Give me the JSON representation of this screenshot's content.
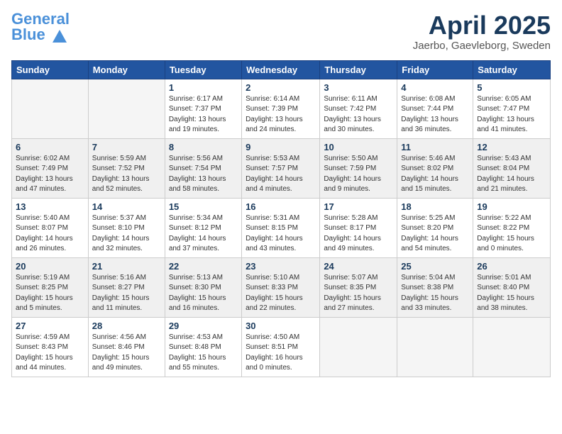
{
  "header": {
    "logo_line1": "General",
    "logo_line2": "Blue",
    "month": "April 2025",
    "location": "Jaerbo, Gaevleborg, Sweden"
  },
  "weekdays": [
    "Sunday",
    "Monday",
    "Tuesday",
    "Wednesday",
    "Thursday",
    "Friday",
    "Saturday"
  ],
  "weeks": [
    [
      {
        "day": "",
        "text": ""
      },
      {
        "day": "",
        "text": ""
      },
      {
        "day": "1",
        "text": "Sunrise: 6:17 AM\nSunset: 7:37 PM\nDaylight: 13 hours\nand 19 minutes."
      },
      {
        "day": "2",
        "text": "Sunrise: 6:14 AM\nSunset: 7:39 PM\nDaylight: 13 hours\nand 24 minutes."
      },
      {
        "day": "3",
        "text": "Sunrise: 6:11 AM\nSunset: 7:42 PM\nDaylight: 13 hours\nand 30 minutes."
      },
      {
        "day": "4",
        "text": "Sunrise: 6:08 AM\nSunset: 7:44 PM\nDaylight: 13 hours\nand 36 minutes."
      },
      {
        "day": "5",
        "text": "Sunrise: 6:05 AM\nSunset: 7:47 PM\nDaylight: 13 hours\nand 41 minutes."
      }
    ],
    [
      {
        "day": "6",
        "text": "Sunrise: 6:02 AM\nSunset: 7:49 PM\nDaylight: 13 hours\nand 47 minutes."
      },
      {
        "day": "7",
        "text": "Sunrise: 5:59 AM\nSunset: 7:52 PM\nDaylight: 13 hours\nand 52 minutes."
      },
      {
        "day": "8",
        "text": "Sunrise: 5:56 AM\nSunset: 7:54 PM\nDaylight: 13 hours\nand 58 minutes."
      },
      {
        "day": "9",
        "text": "Sunrise: 5:53 AM\nSunset: 7:57 PM\nDaylight: 14 hours\nand 4 minutes."
      },
      {
        "day": "10",
        "text": "Sunrise: 5:50 AM\nSunset: 7:59 PM\nDaylight: 14 hours\nand 9 minutes."
      },
      {
        "day": "11",
        "text": "Sunrise: 5:46 AM\nSunset: 8:02 PM\nDaylight: 14 hours\nand 15 minutes."
      },
      {
        "day": "12",
        "text": "Sunrise: 5:43 AM\nSunset: 8:04 PM\nDaylight: 14 hours\nand 21 minutes."
      }
    ],
    [
      {
        "day": "13",
        "text": "Sunrise: 5:40 AM\nSunset: 8:07 PM\nDaylight: 14 hours\nand 26 minutes."
      },
      {
        "day": "14",
        "text": "Sunrise: 5:37 AM\nSunset: 8:10 PM\nDaylight: 14 hours\nand 32 minutes."
      },
      {
        "day": "15",
        "text": "Sunrise: 5:34 AM\nSunset: 8:12 PM\nDaylight: 14 hours\nand 37 minutes."
      },
      {
        "day": "16",
        "text": "Sunrise: 5:31 AM\nSunset: 8:15 PM\nDaylight: 14 hours\nand 43 minutes."
      },
      {
        "day": "17",
        "text": "Sunrise: 5:28 AM\nSunset: 8:17 PM\nDaylight: 14 hours\nand 49 minutes."
      },
      {
        "day": "18",
        "text": "Sunrise: 5:25 AM\nSunset: 8:20 PM\nDaylight: 14 hours\nand 54 minutes."
      },
      {
        "day": "19",
        "text": "Sunrise: 5:22 AM\nSunset: 8:22 PM\nDaylight: 15 hours\nand 0 minutes."
      }
    ],
    [
      {
        "day": "20",
        "text": "Sunrise: 5:19 AM\nSunset: 8:25 PM\nDaylight: 15 hours\nand 5 minutes."
      },
      {
        "day": "21",
        "text": "Sunrise: 5:16 AM\nSunset: 8:27 PM\nDaylight: 15 hours\nand 11 minutes."
      },
      {
        "day": "22",
        "text": "Sunrise: 5:13 AM\nSunset: 8:30 PM\nDaylight: 15 hours\nand 16 minutes."
      },
      {
        "day": "23",
        "text": "Sunrise: 5:10 AM\nSunset: 8:33 PM\nDaylight: 15 hours\nand 22 minutes."
      },
      {
        "day": "24",
        "text": "Sunrise: 5:07 AM\nSunset: 8:35 PM\nDaylight: 15 hours\nand 27 minutes."
      },
      {
        "day": "25",
        "text": "Sunrise: 5:04 AM\nSunset: 8:38 PM\nDaylight: 15 hours\nand 33 minutes."
      },
      {
        "day": "26",
        "text": "Sunrise: 5:01 AM\nSunset: 8:40 PM\nDaylight: 15 hours\nand 38 minutes."
      }
    ],
    [
      {
        "day": "27",
        "text": "Sunrise: 4:59 AM\nSunset: 8:43 PM\nDaylight: 15 hours\nand 44 minutes."
      },
      {
        "day": "28",
        "text": "Sunrise: 4:56 AM\nSunset: 8:46 PM\nDaylight: 15 hours\nand 49 minutes."
      },
      {
        "day": "29",
        "text": "Sunrise: 4:53 AM\nSunset: 8:48 PM\nDaylight: 15 hours\nand 55 minutes."
      },
      {
        "day": "30",
        "text": "Sunrise: 4:50 AM\nSunset: 8:51 PM\nDaylight: 16 hours\nand 0 minutes."
      },
      {
        "day": "",
        "text": ""
      },
      {
        "day": "",
        "text": ""
      },
      {
        "day": "",
        "text": ""
      }
    ]
  ]
}
